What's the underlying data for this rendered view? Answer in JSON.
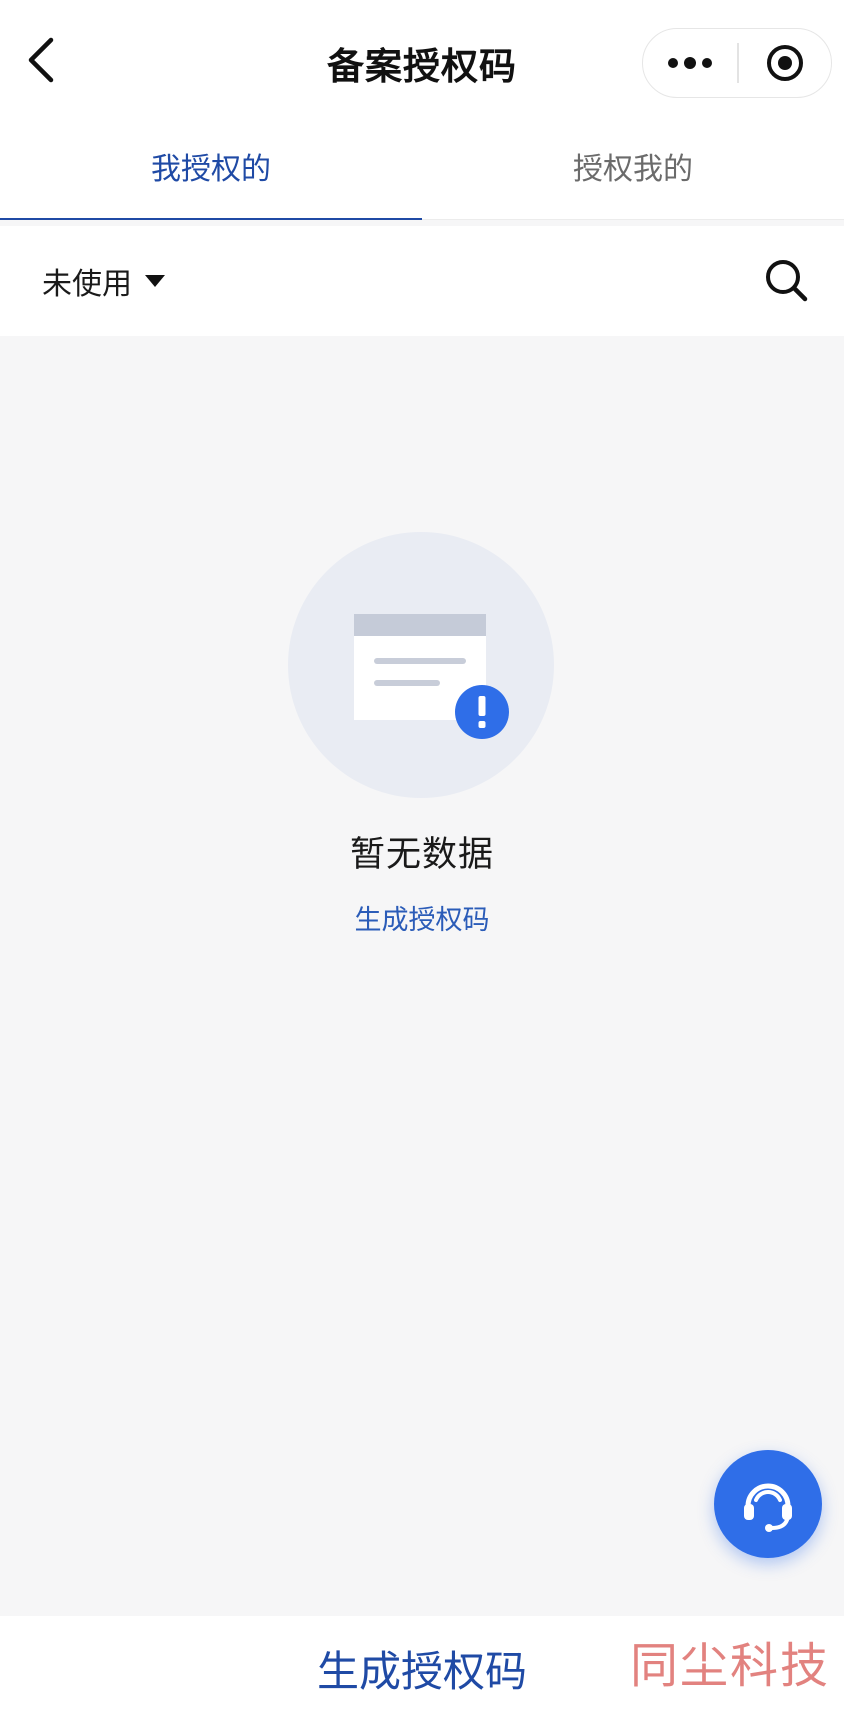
{
  "header": {
    "title": "备案授权码"
  },
  "tabs": [
    {
      "label": "我授权的",
      "active": true
    },
    {
      "label": "授权我的",
      "active": false
    }
  ],
  "filter": {
    "status_value": "未使用"
  },
  "empty_state": {
    "message": "暂无数据",
    "action_label": "生成授权码"
  },
  "bottom": {
    "button_label": "生成授权码",
    "watermark": "同尘科技"
  },
  "colors": {
    "accent": "#1f4aa5",
    "fab": "#2f6ee8",
    "background": "#f6f6f7",
    "watermark": "#e2827f"
  },
  "icons": [
    "back-arrow-icon",
    "more-icon",
    "close-circle-icon",
    "dropdown-triangle-icon",
    "search-icon",
    "empty-document-icon",
    "customer-service-icon"
  ]
}
